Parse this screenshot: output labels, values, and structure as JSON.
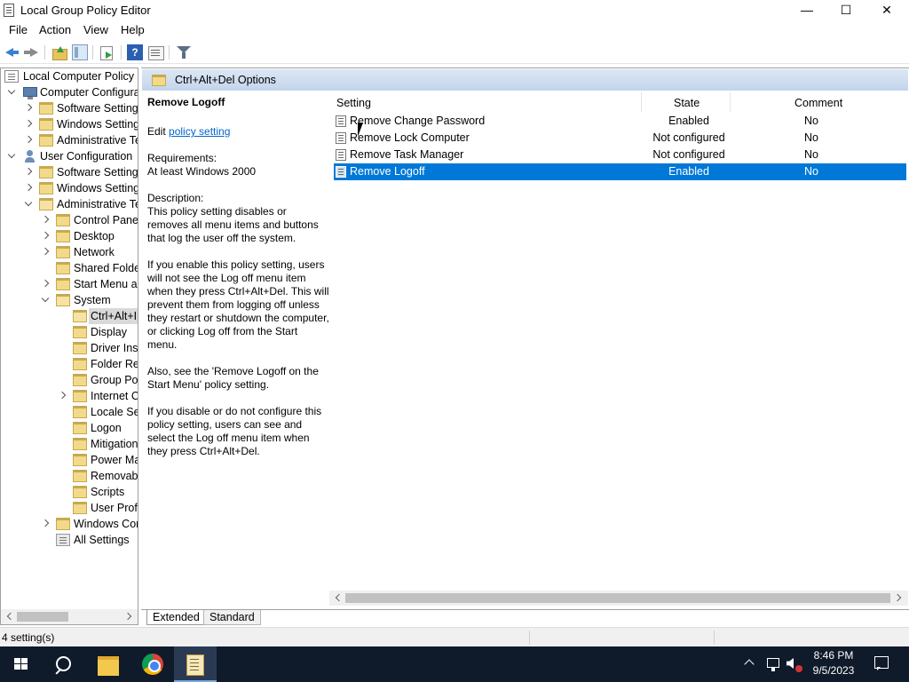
{
  "window": {
    "title": "Local Group Policy Editor",
    "controls": {
      "minimize": "—",
      "maximize": "☐",
      "close": "✕"
    }
  },
  "menu": [
    "File",
    "Action",
    "View",
    "Help"
  ],
  "toolbar": {
    "icons": [
      "back-icon",
      "forward-icon",
      "up-one-level-icon",
      "show-hide-tree-icon",
      "export-list-icon",
      "help-icon",
      "properties-icon",
      "filter-icon"
    ],
    "help_label": "?"
  },
  "tree": {
    "items": [
      {
        "label": "Local Computer Policy",
        "icon": "policy-root-icon",
        "expander": "none"
      },
      {
        "label": "Computer Configura",
        "icon": "computer-icon",
        "expander": "expanded"
      },
      {
        "label": "Software Settings",
        "icon": "folder-icon",
        "expander": "collapsed"
      },
      {
        "label": "Windows Setting",
        "icon": "folder-icon",
        "expander": "collapsed"
      },
      {
        "label": "Administrative Te",
        "icon": "folder-icon",
        "expander": "collapsed"
      },
      {
        "label": "User Configuration",
        "icon": "user-icon",
        "expander": "expanded"
      },
      {
        "label": "Software Settings",
        "icon": "folder-icon",
        "expander": "collapsed"
      },
      {
        "label": "Windows Setting",
        "icon": "folder-icon",
        "expander": "collapsed"
      },
      {
        "label": "Administrative Te",
        "icon": "folder-open-icon",
        "expander": "expanded"
      },
      {
        "label": "Control Panel",
        "icon": "folder-icon",
        "expander": "collapsed"
      },
      {
        "label": "Desktop",
        "icon": "folder-icon",
        "expander": "collapsed"
      },
      {
        "label": "Network",
        "icon": "folder-icon",
        "expander": "collapsed"
      },
      {
        "label": "Shared Folder",
        "icon": "folder-icon",
        "expander": "none"
      },
      {
        "label": "Start Menu ar",
        "icon": "folder-icon",
        "expander": "collapsed"
      },
      {
        "label": "System",
        "icon": "folder-open-icon",
        "expander": "expanded"
      },
      {
        "label": "Ctrl+Alt+I",
        "icon": "folder-open-icon",
        "expander": "none",
        "selected": true
      },
      {
        "label": "Display",
        "icon": "folder-icon",
        "expander": "none"
      },
      {
        "label": "Driver Inst",
        "icon": "folder-icon",
        "expander": "none"
      },
      {
        "label": "Folder Rec",
        "icon": "folder-icon",
        "expander": "none"
      },
      {
        "label": "Group Pol",
        "icon": "folder-icon",
        "expander": "none"
      },
      {
        "label": "Internet C",
        "icon": "folder-icon",
        "expander": "collapsed"
      },
      {
        "label": "Locale Ser",
        "icon": "folder-icon",
        "expander": "none"
      },
      {
        "label": "Logon",
        "icon": "folder-icon",
        "expander": "none"
      },
      {
        "label": "Mitigation",
        "icon": "folder-icon",
        "expander": "none"
      },
      {
        "label": "Power Ma",
        "icon": "folder-icon",
        "expander": "none"
      },
      {
        "label": "Removabl",
        "icon": "folder-icon",
        "expander": "none"
      },
      {
        "label": "Scripts",
        "icon": "folder-icon",
        "expander": "none"
      },
      {
        "label": "User Profi",
        "icon": "folder-icon",
        "expander": "none"
      },
      {
        "label": "Windows Cor",
        "icon": "folder-icon",
        "expander": "collapsed"
      },
      {
        "label": "All Settings",
        "icon": "allsettings-icon",
        "expander": "none"
      }
    ]
  },
  "pane": {
    "header_title": "Ctrl+Alt+Del Options"
  },
  "description": {
    "title": "Remove Logoff",
    "edit_prefix": "Edit",
    "edit_link": "policy setting",
    "requirements_label": "Requirements:",
    "requirements_value": "At least Windows 2000",
    "description_label": "Description:",
    "para1": "This policy setting disables or removes all menu items and buttons that log the user off the system.",
    "para2": "If you enable this policy setting, users will not see the Log off menu item when they press Ctrl+Alt+Del. This will prevent them from logging off unless they restart or shutdown the computer, or clicking Log off from the Start menu.",
    "para3": "Also, see the 'Remove Logoff on the Start Menu' policy setting.",
    "para4": "If you disable or do not configure this policy setting, users can see and select the Log off menu item when they press Ctrl+Alt+Del."
  },
  "list": {
    "columns": [
      "Setting",
      "State",
      "Comment"
    ],
    "rows": [
      {
        "setting": "Remove Change Password",
        "state": "Enabled",
        "comment": "No"
      },
      {
        "setting": "Remove Lock Computer",
        "state": "Not configured",
        "comment": "No"
      },
      {
        "setting": "Remove Task Manager",
        "state": "Not configured",
        "comment": "No"
      },
      {
        "setting": "Remove Logoff",
        "state": "Enabled",
        "comment": "No",
        "selected": true
      }
    ]
  },
  "tabs": [
    "Extended",
    "Standard"
  ],
  "status": {
    "text": "4 setting(s)"
  },
  "taskbar": {
    "apps": [
      "start-icon",
      "search-icon",
      "file-explorer-icon",
      "chrome-icon",
      "gpedit-icon"
    ],
    "time": "8:46 PM",
    "date": "9/5/2023"
  },
  "colors": {
    "selection": "#0078d7",
    "link": "#0066cc",
    "taskbar": "#0f1a2a"
  }
}
